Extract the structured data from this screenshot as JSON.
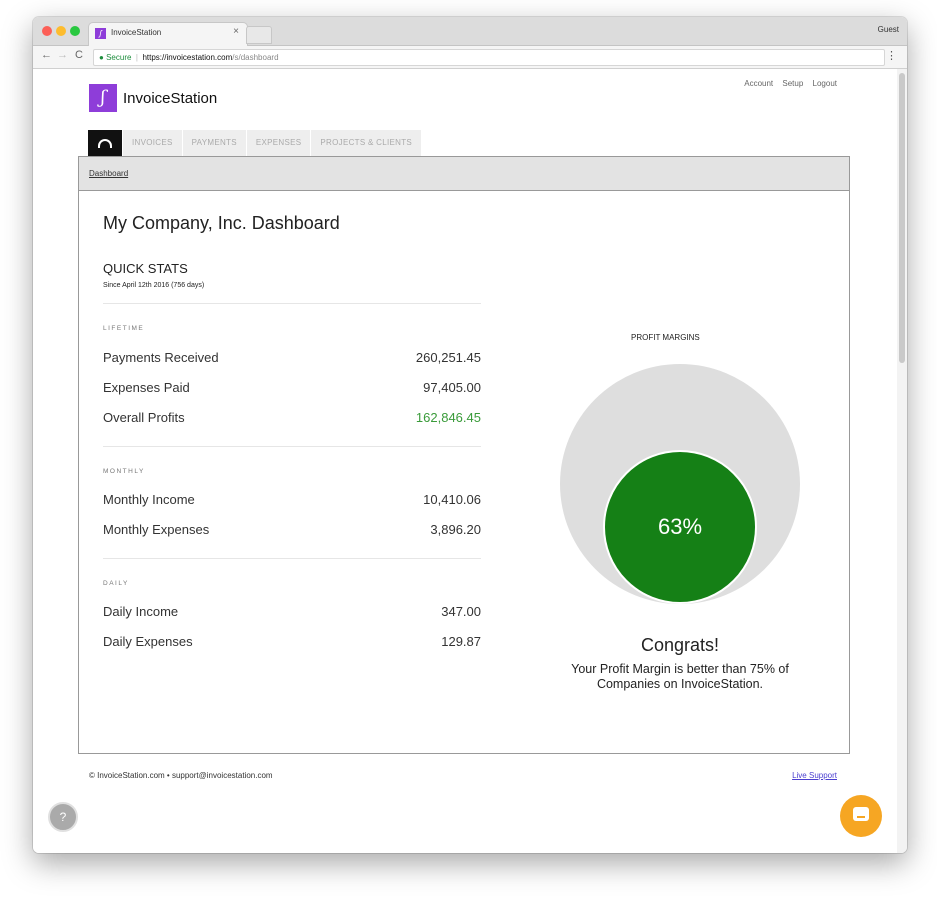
{
  "browser": {
    "tab_title": "InvoiceStation",
    "tab_close": "×",
    "guest": "Guest",
    "secure": "Secure",
    "url_host": "https://invoicestation.com",
    "url_path": "/s/dashboard",
    "favicon_char": "ʃ",
    "back": "←",
    "forward": "→",
    "reload": "C",
    "menu": "⋮",
    "lock": "🔒"
  },
  "header": {
    "logo_char": "ʃ",
    "brand": "InvoiceStation",
    "links": [
      "Account",
      "Setup",
      "Logout"
    ]
  },
  "nav": {
    "items": [
      "INVOICES",
      "PAYMENTS",
      "EXPENSES",
      "PROJECTS & CLIENTS"
    ]
  },
  "breadcrumb": "Dashboard",
  "main": {
    "title": "My Company, Inc. Dashboard",
    "quick_stats_title": "QUICK STATS",
    "quick_stats_sub": "Since April 12th 2016 (756 days)",
    "lifetime": {
      "label": "LIFETIME",
      "rows": [
        {
          "label": "Payments Received",
          "value": "260,251.45"
        },
        {
          "label": "Expenses Paid",
          "value": "97,405.00"
        },
        {
          "label": "Overall Profits",
          "value": "162,846.45"
        }
      ]
    },
    "monthly": {
      "label": "MONTHLY",
      "rows": [
        {
          "label": "Monthly Income",
          "value": "10,410.06"
        },
        {
          "label": "Monthly Expenses",
          "value": "3,896.20"
        }
      ]
    },
    "daily": {
      "label": "DAILY",
      "rows": [
        {
          "label": "Daily Income",
          "value": "347.00"
        },
        {
          "label": "Daily Expenses",
          "value": "129.87"
        }
      ]
    }
  },
  "profit": {
    "title": "PROFIT MARGINS",
    "percent": "63%",
    "congrats": "Congrats!",
    "message": "Your Profit Margin is better than 75% of Companies on InvoiceStation.",
    "colors": {
      "inner": "#158016",
      "outer": "#dedede"
    }
  },
  "footer": {
    "left": "© InvoiceStation.com • support@invoicestation.com",
    "right": "Live Support"
  },
  "widgets": {
    "help": "?"
  },
  "colors": {
    "accent": "#8e3dd9",
    "profit_text": "#3a9b3a",
    "chat": "#f6a623"
  }
}
